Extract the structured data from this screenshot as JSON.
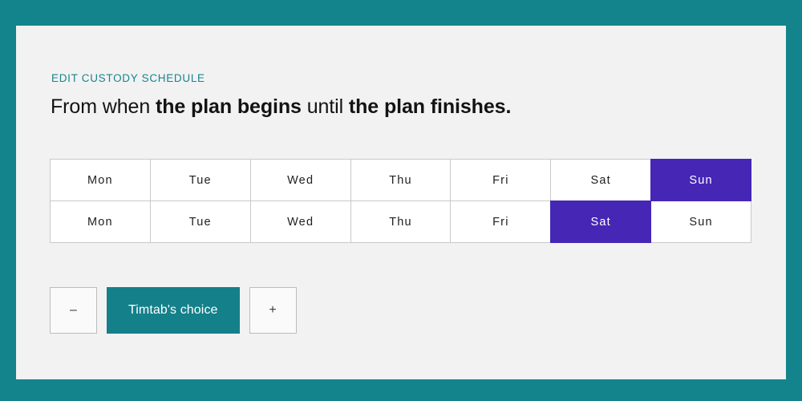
{
  "theme": {
    "frame_color": "#13848b",
    "panel_bg": "#f2f2f3",
    "accent_teal": "#14808a",
    "selected_purple": "#4526b5",
    "cell_border": "#c9c9c9",
    "text_dark": "#131313"
  },
  "header": {
    "eyebrow": "EDIT CUSTODY SCHEDULE",
    "headline": {
      "part_1": "From when ",
      "bold_1": "the plan begins",
      "part_2": " until ",
      "bold_2": "the plan finishes",
      "part_3": "."
    }
  },
  "schedule": {
    "rows": [
      {
        "row_label": "week-1",
        "cells": [
          {
            "label": "Mon",
            "selected": false
          },
          {
            "label": "Tue",
            "selected": false
          },
          {
            "label": "Wed",
            "selected": false
          },
          {
            "label": "Thu",
            "selected": false
          },
          {
            "label": "Fri",
            "selected": false
          },
          {
            "label": "Sat",
            "selected": false
          },
          {
            "label": "Sun",
            "selected": true
          }
        ]
      },
      {
        "row_label": "week-2",
        "cells": [
          {
            "label": "Mon",
            "selected": false
          },
          {
            "label": "Tue",
            "selected": false
          },
          {
            "label": "Wed",
            "selected": false
          },
          {
            "label": "Thu",
            "selected": false
          },
          {
            "label": "Fri",
            "selected": false
          },
          {
            "label": "Sat",
            "selected": true
          },
          {
            "label": "Sun",
            "selected": false
          }
        ]
      }
    ]
  },
  "controls": {
    "decrement_label": "–",
    "primary_label": "Timtab's choice",
    "increment_label": "+"
  }
}
